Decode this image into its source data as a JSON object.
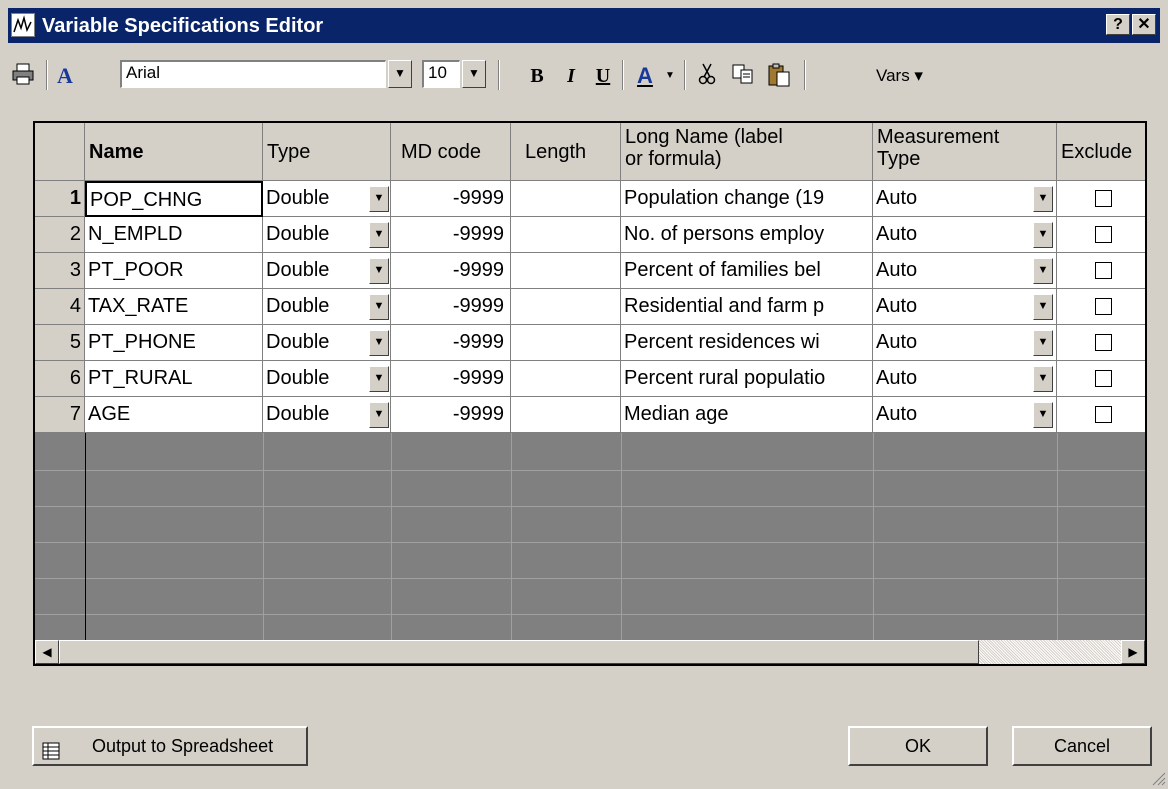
{
  "window": {
    "title": "Variable Specifications Editor",
    "help_label": "?",
    "close_label": "✕"
  },
  "toolbar": {
    "font_name": "Arial",
    "font_size": "10",
    "bold_label": "B",
    "italic_label": "I",
    "underline_label": "U",
    "font_color_label": "A",
    "vars_label": "Vars ▾"
  },
  "grid": {
    "columns": [
      "Name",
      "Type",
      "MD code",
      "Length",
      "Long Name (label\nor formula)",
      "Measurement\nType",
      "Exclude"
    ],
    "rows": [
      {
        "n": "1",
        "name": "POP_CHNG",
        "type": "Double",
        "md": "-9999",
        "length": "",
        "long": "Population change (19",
        "meas": "Auto"
      },
      {
        "n": "2",
        "name": "N_EMPLD",
        "type": "Double",
        "md": "-9999",
        "length": "",
        "long": "No. of persons employ",
        "meas": "Auto"
      },
      {
        "n": "3",
        "name": "PT_POOR",
        "type": "Double",
        "md": "-9999",
        "length": "",
        "long": "Percent of families bel",
        "meas": "Auto"
      },
      {
        "n": "4",
        "name": "TAX_RATE",
        "type": "Double",
        "md": "-9999",
        "length": "",
        "long": "Residential and farm p",
        "meas": "Auto"
      },
      {
        "n": "5",
        "name": "PT_PHONE",
        "type": "Double",
        "md": "-9999",
        "length": "",
        "long": "Percent residences wi",
        "meas": "Auto"
      },
      {
        "n": "6",
        "name": "PT_RURAL",
        "type": "Double",
        "md": "-9999",
        "length": "",
        "long": "Percent rural populatio",
        "meas": "Auto"
      },
      {
        "n": "7",
        "name": "AGE",
        "type": "Double",
        "md": "-9999",
        "length": "",
        "long": "Median age",
        "meas": "Auto"
      }
    ]
  },
  "footer": {
    "output_label": "Output to Spreadsheet",
    "ok_label": "OK",
    "cancel_label": "Cancel"
  },
  "colors": {
    "titlebar": "#0a246a",
    "face": "#d4d0c8",
    "grid_empty": "#808080"
  }
}
